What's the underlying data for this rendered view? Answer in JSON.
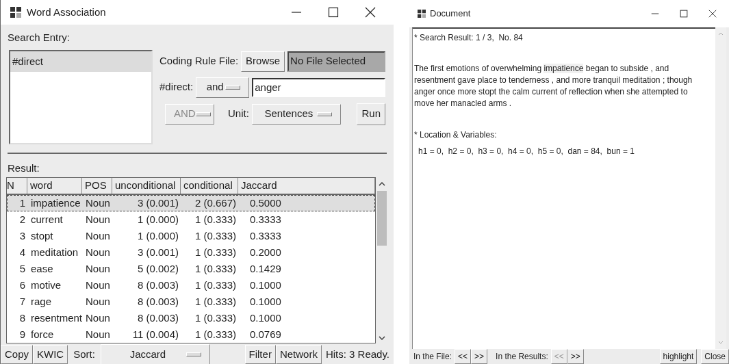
{
  "word_association": {
    "title": "Word Association",
    "search_entry_label": "Search Entry:",
    "entries": [
      {
        "label": "#direct",
        "selected": true
      }
    ],
    "coding_rule_label": "Coding Rule File:",
    "browse_button": "Browse",
    "file_field": "No File Selected",
    "direct_label": "#direct:",
    "direct_operator": {
      "value": "and",
      "disabled": false
    },
    "direct_query": "anger",
    "logic_operator": {
      "value": "AND",
      "disabled": true
    },
    "unit_label": "Unit:",
    "unit": {
      "value": "Sentences",
      "disabled": false
    },
    "run_button": "Run",
    "result_label": "Result:",
    "table": {
      "columns": [
        "N",
        "word",
        "POS",
        "unconditional",
        "conditional",
        "Jaccard"
      ],
      "rows": [
        {
          "cells": [
            "1",
            "impatience",
            "Noun",
            "3 (0.001)",
            "2 (0.667)",
            "0.5000"
          ],
          "selected": true
        },
        {
          "cells": [
            "2",
            "current",
            "Noun",
            "1 (0.000)",
            "1 (0.333)",
            "0.3333"
          ],
          "selected": false
        },
        {
          "cells": [
            "3",
            "stopt",
            "Noun",
            "1 (0.000)",
            "1 (0.333)",
            "0.3333"
          ],
          "selected": false
        },
        {
          "cells": [
            "4",
            "meditation",
            "Noun",
            "3 (0.001)",
            "1 (0.333)",
            "0.2000"
          ],
          "selected": false
        },
        {
          "cells": [
            "5",
            "ease",
            "Noun",
            "5 (0.002)",
            "1 (0.333)",
            "0.1429"
          ],
          "selected": false
        },
        {
          "cells": [
            "6",
            "motive",
            "Noun",
            "8 (0.003)",
            "1 (0.333)",
            "0.1000"
          ],
          "selected": false
        },
        {
          "cells": [
            "7",
            "rage",
            "Noun",
            "8 (0.003)",
            "1 (0.333)",
            "0.1000"
          ],
          "selected": false
        },
        {
          "cells": [
            "8",
            "resentment",
            "Noun",
            "8 (0.003)",
            "1 (0.333)",
            "0.1000"
          ],
          "selected": false
        },
        {
          "cells": [
            "9",
            "force",
            "Noun",
            "11 (0.004)",
            "1 (0.333)",
            "0.0769"
          ],
          "selected": false
        }
      ]
    },
    "bottom_bar": {
      "copy_button": "Copy",
      "kwic_button": "KWIC",
      "sort_label": "Sort:",
      "sort": {
        "value": "Jaccard",
        "disabled": false
      },
      "filter_button": "Filter",
      "network_button": "Network",
      "status": "Hits: 3 Ready."
    }
  },
  "document": {
    "title": "Document",
    "search_result": "* Search Result: 1 / 3,  No. 84",
    "paragraph": [
      {
        "text": "The first emotions of overwhelming ",
        "highlighted": false
      },
      {
        "text": "impatience",
        "highlighted": true
      },
      {
        "text": " began to subside , and resentment gave place to tenderness , and more tranquil meditation ; though anger once more stopt the calm current of reflection when she attempted to move her manacled arms .",
        "highlighted": false
      }
    ],
    "location_heading": "* Location & Variables:",
    "variables": "h1 = 0,  h2 = 0,  h3 = 0,  h4 = 0,  h5 = 0,  dan = 84,  bun = 1",
    "file_nav_label": "In the File:",
    "file_nav": [
      {
        "label": "<<",
        "disabled": false
      },
      {
        "label": ">>",
        "disabled": false
      }
    ],
    "results_nav_label": "In the Results:",
    "results_nav": [
      {
        "label": "<<",
        "disabled": true
      },
      {
        "label": ">>",
        "disabled": false
      }
    ],
    "highlight_button": "highlight",
    "close_button": "Close"
  }
}
